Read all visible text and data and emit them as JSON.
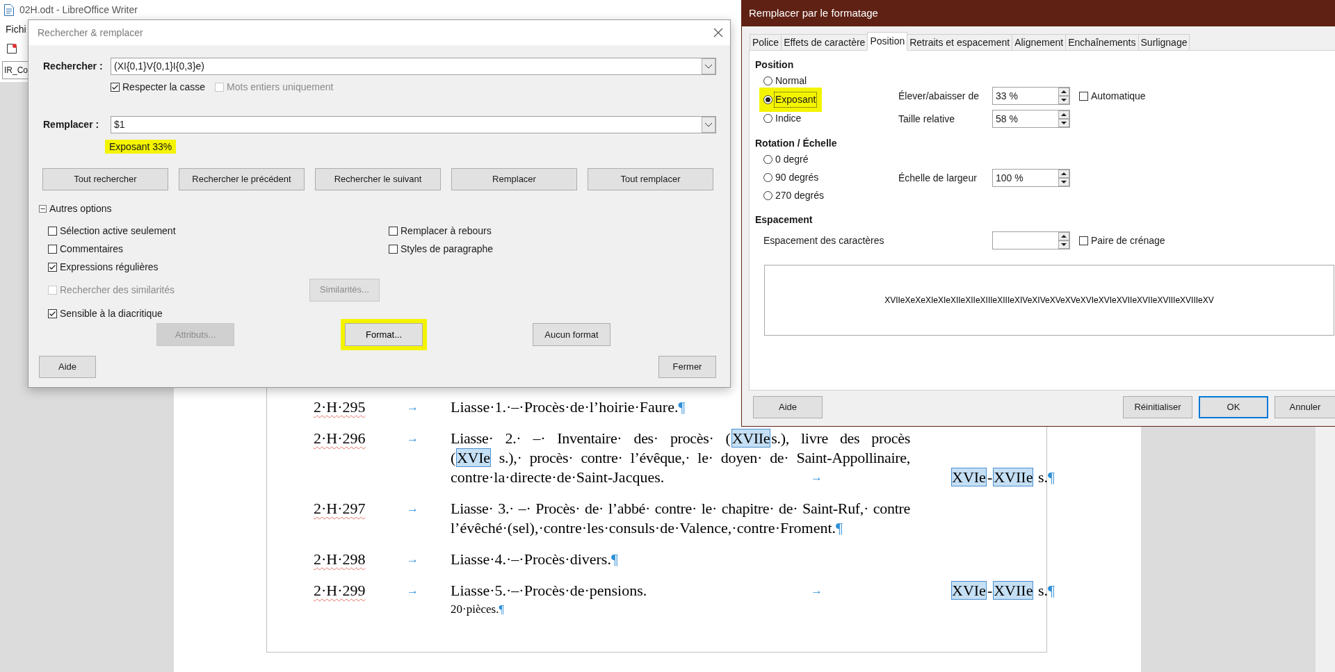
{
  "app": {
    "title": "02H.odt - LibreOffice Writer",
    "menu_fragment": "Fichi",
    "style_box": "IR_Co"
  },
  "find_dialog": {
    "title": "Rechercher & remplacer",
    "search": {
      "label": "Rechercher :",
      "value": "(XI{0,1}V{0,1}I{0,3}e)"
    },
    "search_options": [
      {
        "label": "Respecter la casse",
        "checked": true,
        "disabled": false
      },
      {
        "label": "Mots entiers uniquement",
        "checked": false,
        "disabled": true
      }
    ],
    "replace": {
      "label": "Remplacer :",
      "value": "$1"
    },
    "replace_format": {
      "text": "Exposant 33%",
      "highlighted": true
    },
    "buttons": [
      "Tout rechercher",
      "Rechercher le précédent",
      "Rechercher le suivant",
      "Remplacer",
      "Tout remplacer"
    ],
    "other_options": {
      "label": "Autres options",
      "expanded": true
    },
    "options_left": [
      {
        "label": "Sélection active seulement",
        "checked": false,
        "disabled": false
      },
      {
        "label": "Commentaires",
        "checked": false,
        "disabled": false
      },
      {
        "label": "Expressions régulières",
        "checked": true,
        "disabled": false
      },
      {
        "label": "Rechercher des similarités",
        "checked": false,
        "disabled": true
      },
      {
        "label": "Sensible à la diacritique",
        "checked": true,
        "disabled": false
      }
    ],
    "options_right": [
      {
        "label": "Remplacer à rebours",
        "checked": false,
        "disabled": false
      },
      {
        "label": "Styles de paragraphe",
        "checked": false,
        "disabled": false
      }
    ],
    "similarity_button": {
      "label": "Similarités...",
      "disabled": true
    },
    "format_buttons": [
      {
        "label": "Attributs...",
        "disabled": true,
        "highlighted": false
      },
      {
        "label": "Format...",
        "disabled": false,
        "highlighted": true
      },
      {
        "label": "Aucun format",
        "disabled": false,
        "highlighted": false
      }
    ],
    "help": "Aide",
    "close": "Fermer"
  },
  "format_dialog": {
    "title": "Remplacer par le formatage",
    "tabs": [
      {
        "label": "Police",
        "selected": false
      },
      {
        "label": "Effets de caractère",
        "selected": false
      },
      {
        "label": "Position",
        "selected": true
      },
      {
        "label": "Retraits et espacement",
        "selected": false
      },
      {
        "label": "Alignement",
        "selected": false
      },
      {
        "label": "Enchaînements",
        "selected": false
      },
      {
        "label": "Surlignage",
        "selected": false
      }
    ],
    "position": {
      "heading": "Position",
      "options": [
        {
          "label": "Normal",
          "selected": false,
          "highlighted": false
        },
        {
          "label": "Exposant",
          "selected": true,
          "highlighted": true
        },
        {
          "label": "Indice",
          "selected": false,
          "highlighted": false
        }
      ]
    },
    "raise": {
      "label": "Élever/abaisser de",
      "value": "33 %"
    },
    "automatic": {
      "label": "Automatique",
      "checked": false
    },
    "relative_size": {
      "label": "Taille relative",
      "value": "58 %"
    },
    "rotation": {
      "heading": "Rotation / Échelle",
      "options": [
        {
          "label": "0 degré",
          "selected": false
        },
        {
          "label": "90 degrés",
          "selected": false
        },
        {
          "label": "270 degrés",
          "selected": false
        }
      ]
    },
    "width_scale": {
      "label": "Échelle de largeur",
      "value": "100 %"
    },
    "spacing": {
      "heading": "Espacement",
      "label": "Espacement des caractères",
      "pair_kerning": {
        "label": "Paire de crénage",
        "checked": false
      }
    },
    "preview": "XVIIeXeXeXIeXIeXIIeXIIeXIIIeXIIIeXIVeXIVeXVeXVeXVIeXVIeXVIIeXVIIeXVIIIeXVIIIeXV",
    "buttons": {
      "help": "Aide",
      "reset": "Réinitialiser",
      "ok": "OK",
      "cancel": "Annuler"
    }
  },
  "document": {
    "entries": [
      {
        "code": "2·H·295",
        "tab": "→",
        "lines": [
          [
            {
              "kind": "text",
              "text": "Liasse·1.·–·Procès·de·l’hoirie·Faure."
            },
            {
              "kind": "mark",
              "text": "¶"
            }
          ]
        ]
      },
      {
        "code": "2·H·296",
        "tab": "→",
        "lines": [
          [
            {
              "kind": "text",
              "text": "Liasse· 2.· –· Inventaire· des· procès· ("
            },
            {
              "kind": "field",
              "text": "XVIIe"
            },
            {
              "kind": "text",
              "text": "s.), livre des procès"
            }
          ],
          [
            {
              "kind": "text",
              "text": "("
            },
            {
              "kind": "field",
              "text": "XVIe"
            },
            {
              "kind": "text",
              "text": " s.),· procès· contre· l’évêque,· le· doyen· de· Saint-Appollinaire,"
            }
          ],
          [
            {
              "kind": "text",
              "text": "contre·la·directe·de·Saint-Jacques."
            }
          ]
        ],
        "end_tab": "→",
        "dates": [
          {
            "kind": "field",
            "text": "XVIe"
          },
          {
            "kind": "text",
            "text": "-"
          },
          {
            "kind": "field",
            "text": "XVIIe"
          },
          {
            "kind": "text",
            "text": " s."
          },
          {
            "kind": "mark",
            "text": "¶"
          }
        ]
      },
      {
        "code": "2·H·297",
        "tab": "→",
        "lines": [
          [
            {
              "kind": "text",
              "text": "Liasse· 3.· –· Procès· de· l’abbé· contre· le· chapitre· de· Saint-Ruf,· contre"
            }
          ],
          [
            {
              "kind": "text",
              "text": "l’évêché·(sel),·contre·les·consuls·de·Valence,·contre·Froment."
            },
            {
              "kind": "mark",
              "text": "¶"
            }
          ]
        ]
      },
      {
        "code": "2·H·298",
        "tab": "→",
        "lines": [
          [
            {
              "kind": "text",
              "text": "Liasse·4.·–·Procès·divers."
            },
            {
              "kind": "mark",
              "text": "¶"
            }
          ]
        ]
      },
      {
        "code": "2·H·299",
        "tab": "→",
        "lines": [
          [
            {
              "kind": "text",
              "text": "Liasse·5.·–·Procès·de·pensions."
            }
          ]
        ],
        "end_tab": "→",
        "dates": [
          {
            "kind": "field",
            "text": "XVIe"
          },
          {
            "kind": "text",
            "text": "-"
          },
          {
            "kind": "field",
            "text": "XVIIe"
          },
          {
            "kind": "text",
            "text": " s."
          },
          {
            "kind": "mark",
            "text": "¶"
          }
        ],
        "note": [
          {
            "kind": "text",
            "text": "20·pièces."
          },
          {
            "kind": "mark",
            "text": "¶"
          }
        ]
      }
    ]
  }
}
